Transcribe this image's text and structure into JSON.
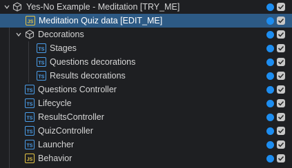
{
  "tree": {
    "root": {
      "label": "Yes-No Example - Meditation  [TRY_ME]",
      "icon": "object-icon"
    },
    "items": [
      {
        "label": "Meditation Quiz data [EDIT_ME]",
        "icon": "js-file-icon",
        "selected": true
      },
      {
        "label": "Decorations",
        "icon": "object-icon",
        "expanded": true
      },
      {
        "label": "Stages",
        "icon": "ts-file-icon"
      },
      {
        "label": "Questions decorations",
        "icon": "ts-file-icon"
      },
      {
        "label": "Results decorations",
        "icon": "ts-file-icon"
      },
      {
        "label": "Questions Controller",
        "icon": "ts-file-icon"
      },
      {
        "label": "Lifecycle",
        "icon": "ts-file-icon"
      },
      {
        "label": "ResultsController",
        "icon": "ts-file-icon"
      },
      {
        "label": "QuizController",
        "icon": "ts-file-icon"
      },
      {
        "label": "Launcher",
        "icon": "ts-file-icon"
      },
      {
        "label": "Behavior",
        "icon": "js-file-icon"
      }
    ]
  },
  "colors": {
    "selection": "#2d5a85",
    "active_dot": "#1d8df0",
    "js_icon": "#e5c445",
    "ts_icon": "#4b9eea"
  }
}
